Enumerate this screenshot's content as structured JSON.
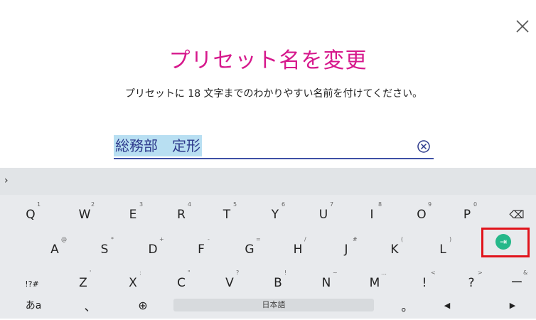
{
  "dialog": {
    "title": "プリセット名を変更",
    "description": "プリセットに 18 文字までのわかりやすい名前を付けてください。",
    "input_value": "総務部　定形"
  },
  "keyboard": {
    "row1": [
      {
        "label": "Q",
        "hint": "1"
      },
      {
        "label": "W",
        "hint": "2"
      },
      {
        "label": "E",
        "hint": "3"
      },
      {
        "label": "R",
        "hint": "4"
      },
      {
        "label": "T",
        "hint": "5"
      },
      {
        "label": "Y",
        "hint": "6"
      },
      {
        "label": "U",
        "hint": "7"
      },
      {
        "label": "I",
        "hint": "8"
      },
      {
        "label": "O",
        "hint": "9"
      },
      {
        "label": "P",
        "hint": "0"
      }
    ],
    "row2": [
      {
        "label": "A",
        "hint": "@"
      },
      {
        "label": "S",
        "hint": "*"
      },
      {
        "label": "D",
        "hint": "+"
      },
      {
        "label": "F",
        "hint": "-"
      },
      {
        "label": "G",
        "hint": "="
      },
      {
        "label": "H",
        "hint": "/"
      },
      {
        "label": "J",
        "hint": "#"
      },
      {
        "label": "K",
        "hint": "("
      },
      {
        "label": "L",
        "hint": ")"
      }
    ],
    "row3": [
      {
        "label": "!?#",
        "hint": ""
      },
      {
        "label": "Z",
        "hint": "'"
      },
      {
        "label": "X",
        "hint": ":"
      },
      {
        "label": "C",
        "hint": "\""
      },
      {
        "label": "V",
        "hint": "?"
      },
      {
        "label": "B",
        "hint": "!"
      },
      {
        "label": "N",
        "hint": "~"
      },
      {
        "label": "M",
        "hint": "…"
      },
      {
        "label": "!",
        "hint": "<"
      },
      {
        "label": "?",
        "hint": ">"
      },
      {
        "label": "ー",
        "hint": "&"
      }
    ],
    "row4": {
      "kana_label": "あa",
      "comma_label": "、",
      "space_label": "日本語",
      "period_label": "。",
      "left_arrow": "◀",
      "right_arrow": "▶"
    },
    "toolbar_chevron": "›",
    "tab_symbol": "⇥",
    "backspace_symbol": "⌫",
    "globe_symbol": "⊕"
  }
}
